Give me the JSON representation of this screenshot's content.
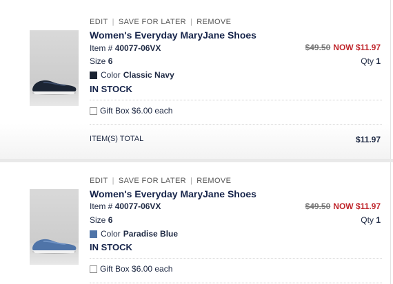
{
  "actions": {
    "edit": "EDIT",
    "save_for_later": "SAVE FOR LATER",
    "remove": "REMOVE"
  },
  "items": [
    {
      "title": "Women's Everyday MaryJane Shoes",
      "item_label": "Item #",
      "item_number": "40077-06VX",
      "size_label": "Size",
      "size": "6",
      "color_label": "Color",
      "color_name": "Classic Navy",
      "color_hex": "#1b2433",
      "stock": "IN STOCK",
      "was_price": "$49.50",
      "now_label": "NOW",
      "now_price": "$11.97",
      "qty_label": "Qty",
      "qty": "1",
      "gift_box": "Gift Box $6.00 each"
    },
    {
      "title": "Women's Everyday MaryJane Shoes",
      "item_label": "Item #",
      "item_number": "40077-06VX",
      "size_label": "Size",
      "size": "6",
      "color_label": "Color",
      "color_name": "Paradise Blue",
      "color_hex": "#4f74a8",
      "stock": "IN STOCK",
      "was_price": "$49.50",
      "now_label": "NOW",
      "now_price": "$11.97",
      "qty_label": "Qty",
      "qty": "1",
      "gift_box": "Gift Box $6.00 each"
    }
  ],
  "summary": {
    "label": "ITEM(S) TOTAL",
    "value": "$11.97"
  }
}
